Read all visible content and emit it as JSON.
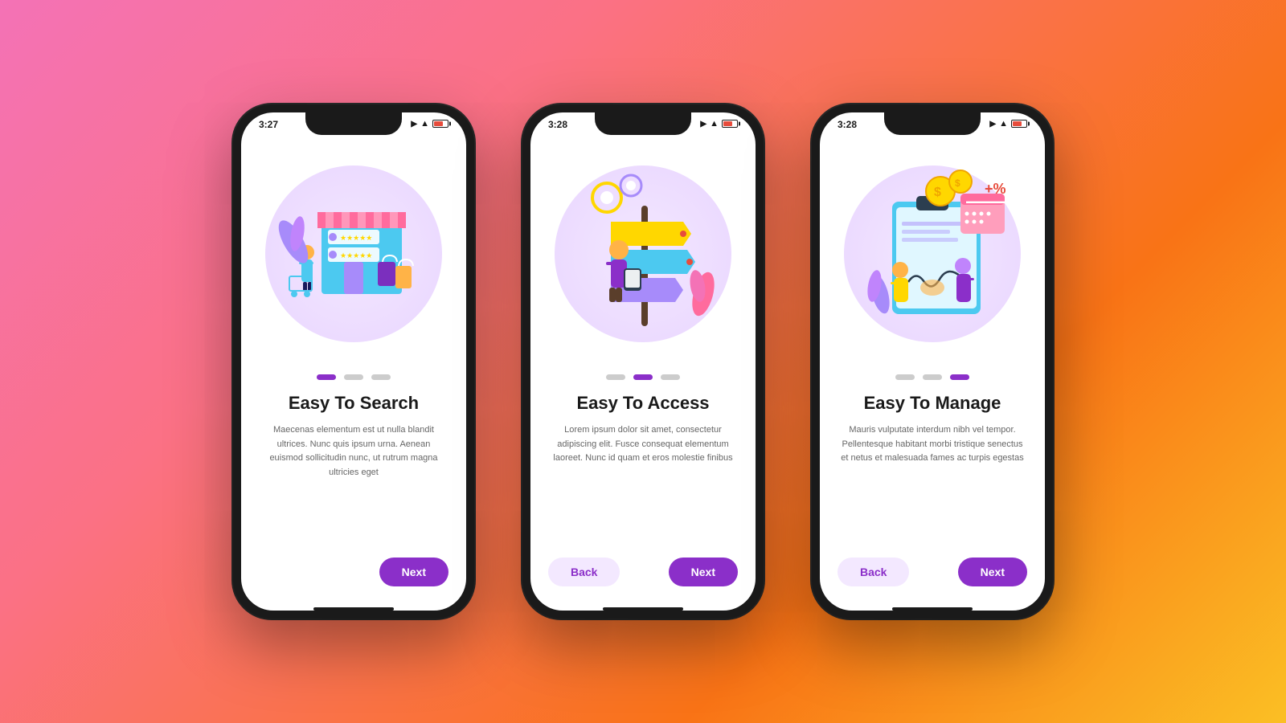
{
  "background": {
    "gradient": "linear-gradient(135deg, #f472b6, #fb7185, #f97316, #fbbf24)"
  },
  "phones": [
    {
      "id": "phone-1",
      "statusBar": {
        "time": "3:27",
        "signal": "●●●",
        "wifi": "wifi",
        "battery": "low"
      },
      "illustration": "shopping",
      "dots": [
        "active",
        "inactive",
        "inactive"
      ],
      "title": "Easy To Search",
      "description": "Maecenas elementum est ut nulla blandit ultrices. Nunc quis ipsum urna. Aenean euismod sollicitudin nunc, ut rutrum magna ultricies eget",
      "buttons": {
        "hasBack": false,
        "nextLabel": "Next",
        "backLabel": null
      }
    },
    {
      "id": "phone-2",
      "statusBar": {
        "time": "3:28",
        "signal": "●●●●",
        "wifi": "wifi",
        "battery": "low"
      },
      "illustration": "navigation",
      "dots": [
        "inactive",
        "active",
        "inactive"
      ],
      "title": "Easy To Access",
      "description": "Lorem ipsum dolor sit amet, consectetur adipiscing elit. Fusce consequat elementum laoreet. Nunc id quam et eros molestie finibus",
      "buttons": {
        "hasBack": true,
        "nextLabel": "Next",
        "backLabel": "Back"
      }
    },
    {
      "id": "phone-3",
      "statusBar": {
        "time": "3:28",
        "signal": "●●●●",
        "wifi": "wifi",
        "battery": "low"
      },
      "illustration": "finance",
      "dots": [
        "inactive",
        "inactive",
        "active"
      ],
      "title": "Easy To Manage",
      "description": "Mauris vulputate interdum nibh vel tempor. Pellentesque habitant morbi tristique senectus et netus et malesuada fames ac turpis egestas",
      "buttons": {
        "hasBack": true,
        "nextLabel": "Next",
        "backLabel": "Back"
      }
    }
  ]
}
